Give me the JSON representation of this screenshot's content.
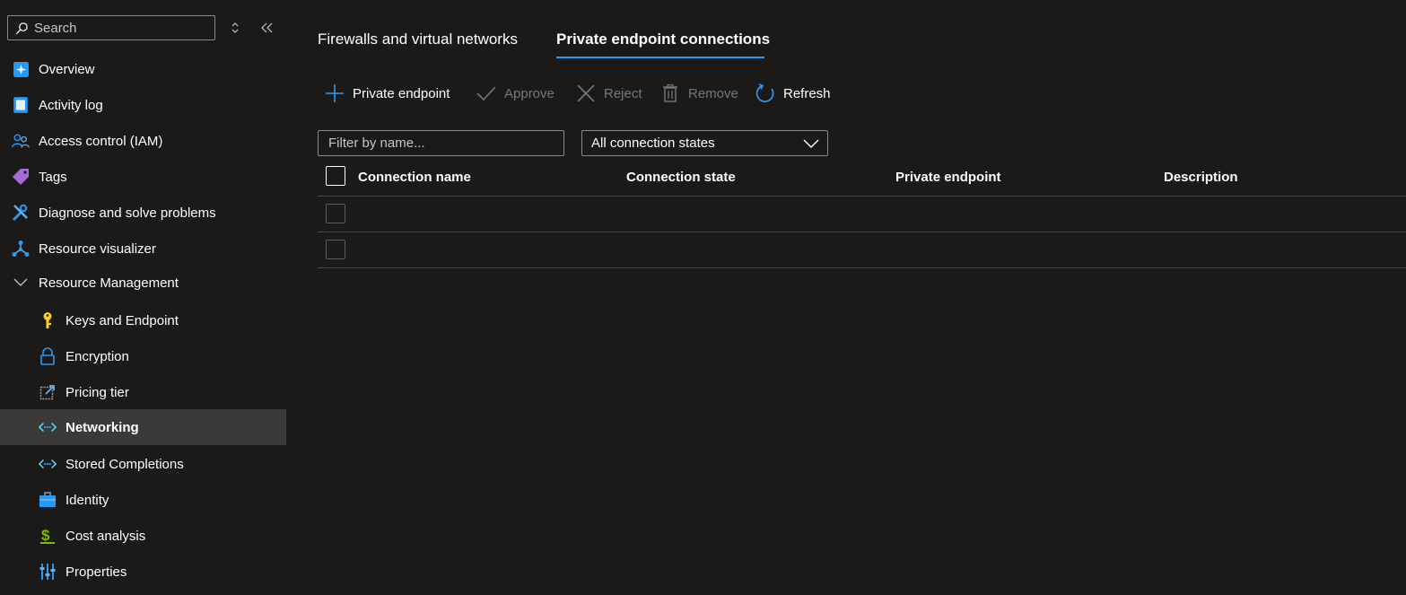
{
  "sidebar": {
    "search_placeholder": "Search",
    "items": [
      {
        "label": "Overview",
        "icon": "overview-icon"
      },
      {
        "label": "Activity log",
        "icon": "activity-log-icon"
      },
      {
        "label": "Access control (IAM)",
        "icon": "people-icon"
      },
      {
        "label": "Tags",
        "icon": "tag-icon"
      },
      {
        "label": "Diagnose and solve problems",
        "icon": "wrench-icon"
      },
      {
        "label": "Resource visualizer",
        "icon": "network-graph-icon"
      },
      {
        "label": "Resource Management",
        "icon": "chevron-down-icon"
      }
    ],
    "sub_items": [
      {
        "label": "Keys and Endpoint",
        "icon": "key-icon"
      },
      {
        "label": "Encryption",
        "icon": "lock-icon"
      },
      {
        "label": "Pricing tier",
        "icon": "external-edit-icon"
      },
      {
        "label": "Networking",
        "icon": "networking-icon",
        "active": true
      },
      {
        "label": "Stored Completions",
        "icon": "networking-icon"
      },
      {
        "label": "Identity",
        "icon": "briefcase-icon"
      },
      {
        "label": "Cost analysis",
        "icon": "dollar-icon"
      },
      {
        "label": "Properties",
        "icon": "properties-icon"
      }
    ]
  },
  "tabs": [
    {
      "label": "Firewalls and virtual networks",
      "active": false
    },
    {
      "label": "Private endpoint connections",
      "active": true
    }
  ],
  "toolbar": {
    "add": "Private endpoint",
    "approve": "Approve",
    "reject": "Reject",
    "remove": "Remove",
    "refresh": "Refresh"
  },
  "filter": {
    "placeholder": "Filter by name...",
    "state_selected": "All connection states"
  },
  "table": {
    "columns": [
      "Connection name",
      "Connection state",
      "Private endpoint",
      "Description"
    ],
    "rows": [
      {},
      {}
    ]
  },
  "colors": {
    "background": "#1b1a19",
    "accent": "#2899f5",
    "active_item": "#3b3a39",
    "disabled_text": "#797775"
  }
}
